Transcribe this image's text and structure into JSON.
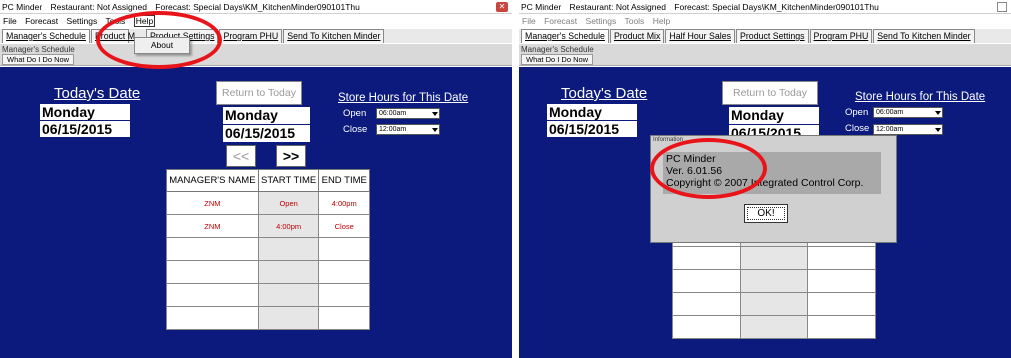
{
  "left": {
    "title": {
      "app": "PC Minder",
      "restaurant": "Restaurant: Not Assigned",
      "forecast": "Forecast: Special Days\\KM_KitchenMinder090101Thu"
    },
    "menu": [
      "File",
      "Forecast",
      "Settings",
      "Tools",
      "Help"
    ],
    "dropdown_item": "About",
    "tabs": [
      "Manager's Schedule",
      "Product M",
      "Product Settings",
      "Program PHU",
      "Send To Kitchen Minder"
    ],
    "screen_label": "Manager's Schedule",
    "what_do": "What Do I Do Now",
    "todays_date_label": "Today's Date",
    "today_day": "Monday",
    "today_date": "06/15/2015",
    "return_btn": "Return to Today",
    "sel_day": "Monday",
    "sel_date": "06/15/2015",
    "prev": "<<",
    "next": ">>",
    "store_hours_title": "Store Hours for This Date",
    "open_label": "Open",
    "open_value": "06:00am",
    "close_label": "Close",
    "close_value": "12:00am",
    "table": {
      "headers": [
        "MANAGER'S NAME",
        "START TIME",
        "END TIME"
      ],
      "rows": [
        [
          "ZNM",
          "Open",
          "4:00pm"
        ],
        [
          "ZNM",
          "4:00pm",
          "Close"
        ],
        [
          "",
          "",
          ""
        ],
        [
          "",
          "",
          ""
        ],
        [
          "",
          "",
          ""
        ],
        [
          "",
          "",
          ""
        ]
      ]
    }
  },
  "right": {
    "title": {
      "app": "PC Minder",
      "restaurant": "Restaurant: Not Assigned",
      "forecast": "Forecast: Special Days\\KM_KitchenMinder090101Thu"
    },
    "menu": [
      "File",
      "Forecast",
      "Settings",
      "Tools",
      "Help"
    ],
    "tabs": [
      "Manager's Schedule",
      "Product Mix",
      "Half Hour Sales",
      "Product Settings",
      "Program PHU",
      "Send To Kitchen Minder"
    ],
    "screen_label": "Manager's Schedule",
    "what_do": "What Do I Do Now",
    "todays_date_label": "Today's Date",
    "today_day": "Monday",
    "today_date": "06/15/2015",
    "return_btn": "Return to Today",
    "sel_day": "Monday",
    "sel_date": "06/15/2015",
    "store_hours_title": "Store Hours for This Date",
    "open_label": "Open",
    "open_value": "06:00am",
    "close_label": "Close",
    "close_value": "12:00am",
    "dialog": {
      "title": "Information",
      "line1": "PC Minder",
      "line2": "Ver. 6.01.56",
      "line3": "Copyright © 2007 Integrated Control Corp.",
      "ok": "OK!"
    }
  },
  "colors": {
    "canvas": "#0b1a7c",
    "highlight_ring": "#e8141a",
    "schedule_text": "#c00000"
  }
}
